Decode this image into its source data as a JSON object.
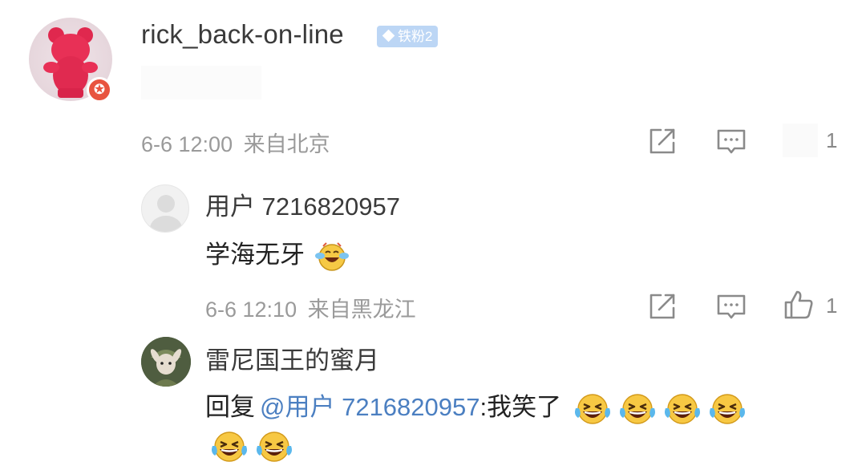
{
  "main_comment": {
    "username": "rick_back-on-line",
    "fan_badge": "铁粉2",
    "timestamp": "6-6 12:00",
    "location": "来自北京",
    "like_count": "1",
    "avatar_icon": "red-bear-figurine-avatar",
    "badge_icon": "verified-star-icon"
  },
  "reply1": {
    "username": "用户 7216820957",
    "text": "学海无牙",
    "emoji": "laughing-crying-emoji",
    "timestamp": "6-6 12:10",
    "location": "来自黑龙江",
    "like_count": "1"
  },
  "reply2": {
    "username": "雷尼国王的蜜月",
    "reply_prefix": "回复",
    "mention": "@用户 7216820957",
    "text": ":我笑了",
    "emoji_icon": "laughing-tears-emoji",
    "emoji_count_line1": 4,
    "emoji_count_line2": 2
  },
  "colors": {
    "mention": "#4b7fc1",
    "meta_text": "#9a9a9a",
    "badge": "#e8543f",
    "fan_badge": "#bcd6f5"
  }
}
